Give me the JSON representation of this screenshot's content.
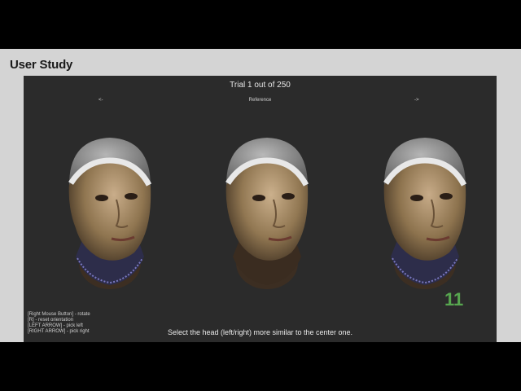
{
  "slide": {
    "title": "User Study",
    "number": "11"
  },
  "app": {
    "trial_text": "Trial 1 out of 250",
    "left_label": "<-",
    "center_label": "Reference",
    "right_label": "->",
    "help": [
      "[Right Mouse Button] - rotate",
      "[R] - reset orientation",
      "[LEFT ARROW] - pick left",
      "[RIGHT ARROW] - pick right"
    ],
    "instruction": "Select the head (left/right) more similar to the center one."
  },
  "colors": {
    "viewport_bg": "#2b2b2b",
    "slide_bg": "#d4d4d4",
    "slide_number": "#57a64f"
  },
  "icons": {
    "heads": "3d-head-render"
  }
}
